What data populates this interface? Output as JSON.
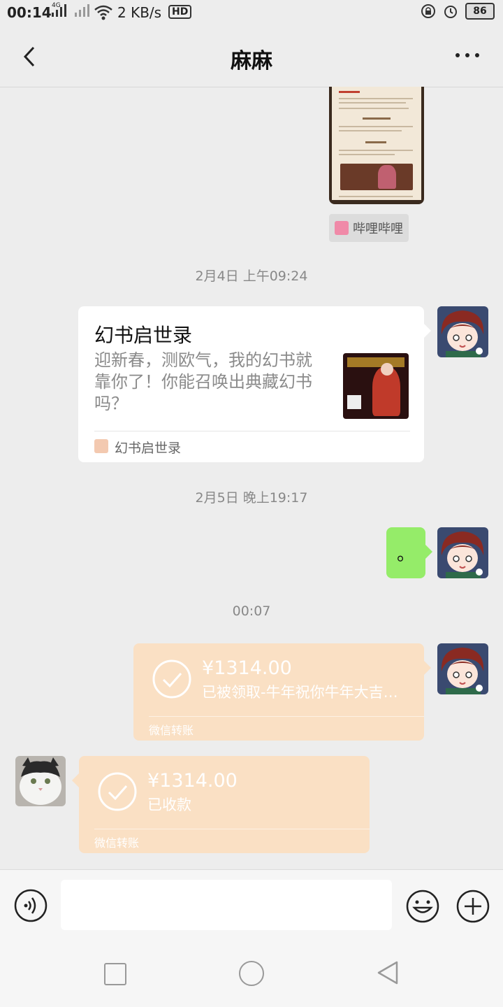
{
  "status": {
    "time": "00:14",
    "network": "4G",
    "speed": "2 KB/s",
    "hd": "HD",
    "battery": "86"
  },
  "header": {
    "title": "麻麻"
  },
  "messages": {
    "shared_source_label": "哔哩哔哩",
    "ts1": "2月4日 上午09:24",
    "card_title": "幻书启世录",
    "card_desc": "迎新春，测欧气，我的幻书就靠你了！你能召唤出典藏幻书吗？",
    "card_source": "幻书启世录",
    "ts2": "2月5日 晚上19:17",
    "green_text": "。",
    "ts3": "00:07",
    "transfer1_amount": "¥1314.00",
    "transfer1_status": "已被领取-牛年祝你牛年大吉…",
    "transfer1_label": "微信转账",
    "transfer2_amount": "¥1314.00",
    "transfer2_status": "已收款",
    "transfer2_label": "微信转账"
  },
  "colors": {
    "bubble_green": "#95ec69",
    "transfer_orange": "#fae0c4",
    "background": "#ededed"
  }
}
